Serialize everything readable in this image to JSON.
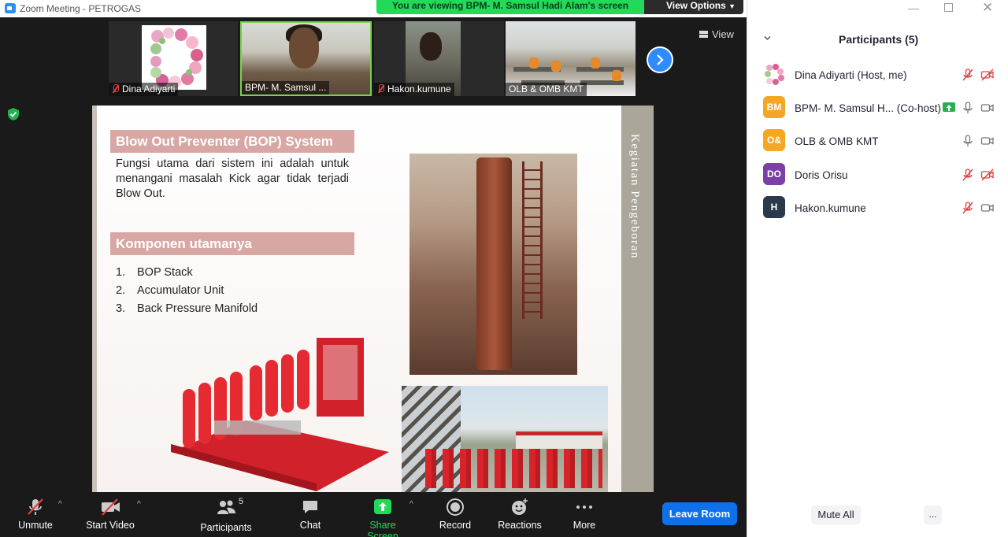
{
  "window": {
    "title": "Zoom Meeting - PETROGAS"
  },
  "banner": {
    "text": "You are viewing BPM- M. Samsul Hadi Alam's screen",
    "view_options": "View Options"
  },
  "thumbnails": [
    {
      "name": "Dina Adiyarti",
      "muted": true
    },
    {
      "name": "BPM- M. Samsul ...",
      "muted": false
    },
    {
      "name": "Hakon.kumune",
      "muted": true
    },
    {
      "name": "OLB & OMB KMT",
      "muted": false
    }
  ],
  "strip": {
    "view_label": "View"
  },
  "slide": {
    "side_title": "Kegiatan Pengeboran",
    "heading1": "Blow Out Preventer (BOP) System",
    "description": "Fungsi utama dari sistem ini adalah untuk menangani masalah Kick agar tidak terjadi Blow Out.",
    "heading2": "Komponen utamanya",
    "components": [
      {
        "num": "1.",
        "text": "BOP Stack"
      },
      {
        "num": "2.",
        "text": "Accumulator Unit"
      },
      {
        "num": "3.",
        "text": "Back Pressure Manifold"
      }
    ]
  },
  "toolbar": {
    "unmute": "Unmute",
    "start_video": "Start Video",
    "participants": "Participants",
    "participants_count": "5",
    "chat": "Chat",
    "share_screen": "Share Screen",
    "record": "Record",
    "reactions": "Reactions",
    "more": "More",
    "leave": "Leave Room"
  },
  "panel": {
    "title": "Participants (5)",
    "participants": [
      {
        "initials": "",
        "name": "Dina Adiyarti (Host, me)",
        "color": "#ffffff",
        "mic": "muted",
        "video": "off",
        "badge": false
      },
      {
        "initials": "BM",
        "name": "BPM- M. Samsul H...  (Co-host)",
        "color": "#f5a623",
        "mic": "on",
        "video": "on",
        "badge": true
      },
      {
        "initials": "O&",
        "name": "OLB & OMB KMT",
        "color": "#f5a623",
        "mic": "on",
        "video": "on",
        "badge": false
      },
      {
        "initials": "DO",
        "name": "Doris Orisu",
        "color": "#7b3fa8",
        "mic": "muted",
        "video": "off",
        "badge": false
      },
      {
        "initials": "H",
        "name": "Hakon.kumune",
        "color": "#2b3a4a",
        "mic": "muted",
        "video": "on",
        "badge": false
      }
    ],
    "mute_all": "Mute All",
    "more": "..."
  },
  "colors": {
    "accent": "#2d8cff",
    "leave": "#0e71eb",
    "banner": "#23d959",
    "muted": "#e04040",
    "share": "#23d959"
  }
}
